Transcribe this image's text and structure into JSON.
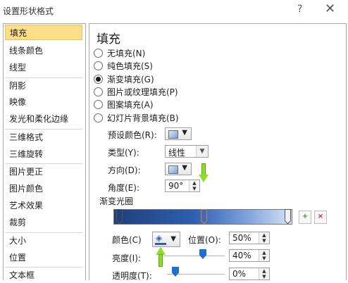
{
  "window": {
    "title": "设置形状格式",
    "help": "?",
    "close": "✕"
  },
  "sidebar": {
    "items": [
      {
        "label": "填充",
        "selected": true
      },
      {
        "label": "线条颜色"
      },
      {
        "label": "线型"
      },
      {
        "label": "阴影"
      },
      {
        "label": "映像"
      },
      {
        "label": "发光和柔化边缘"
      },
      {
        "label": "三维格式"
      },
      {
        "label": "三维旋转"
      },
      {
        "label": "图片更正"
      },
      {
        "label": "图片颜色"
      },
      {
        "label": "艺术效果"
      },
      {
        "label": "裁剪"
      },
      {
        "label": "大小"
      },
      {
        "label": "位置"
      },
      {
        "label": "文本框"
      }
    ]
  },
  "panel": {
    "title": "填充",
    "fill_options": [
      {
        "label": "无填充(N)",
        "checked": false
      },
      {
        "label": "纯色填充(S)",
        "checked": false
      },
      {
        "label": "渐变填充(G)",
        "checked": true
      },
      {
        "label": "图片或纹理填充(P)",
        "checked": false
      },
      {
        "label": "图案填充(A)",
        "checked": false
      },
      {
        "label": "幻灯片背景填充(B)",
        "checked": false
      }
    ],
    "preset_label": "预设颜色(R):",
    "type_label": "类型(Y):",
    "type_value": "线性",
    "direction_label": "方向(D):",
    "angle_label": "角度(E):",
    "angle_value": "90°",
    "stops_label": "渐变光圈",
    "color_label": "颜色(C)",
    "position_label": "位置(O):",
    "position_value": "50%",
    "brightness_label": "亮度(I):",
    "brightness_value": "40%",
    "transparency_label": "透明度(T):",
    "transparency_value": "0%",
    "add_stop_icon": "add-stop-icon",
    "remove_stop_icon": "remove-stop-icon"
  },
  "colors": {
    "selection": "#fddf8a",
    "gradient_dark": "#1f3f7a",
    "gradient_light": "#d6e2f4",
    "annotation_arrow": "#8ddc2a",
    "selected_stop": "#e07b39"
  }
}
